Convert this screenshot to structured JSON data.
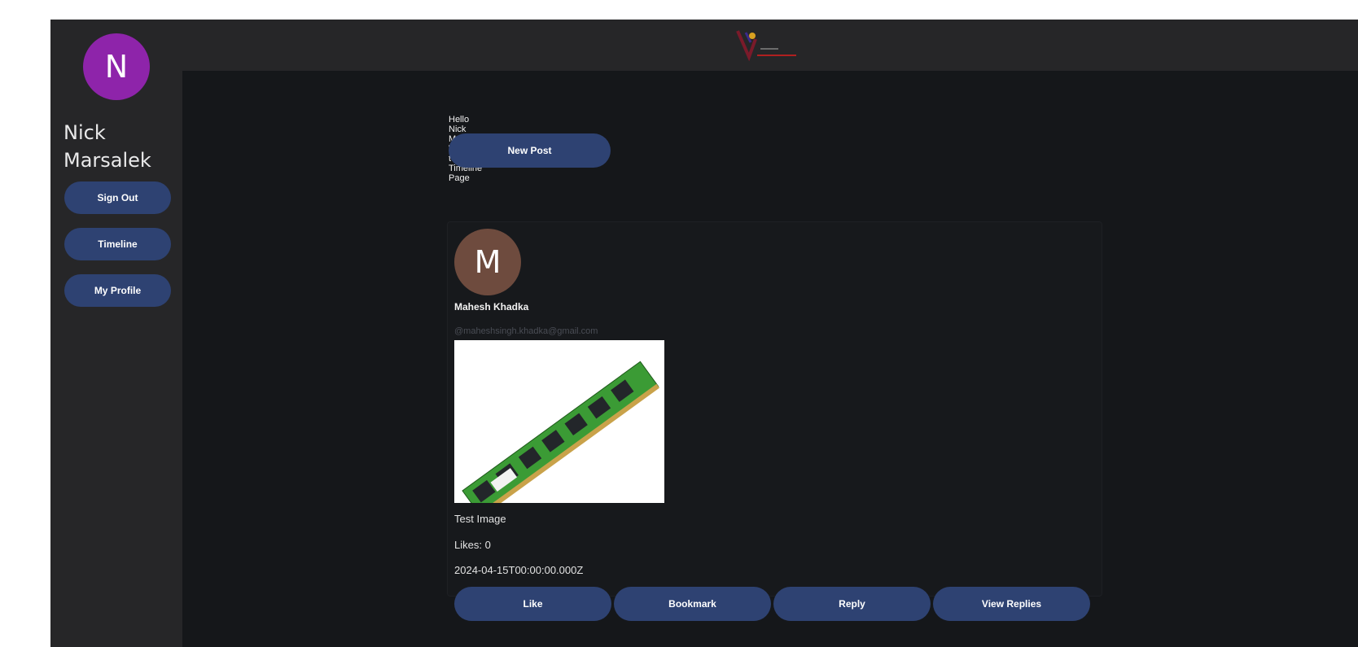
{
  "sidebar": {
    "avatar_letter": "N",
    "username": "Nick Marsalek",
    "buttons": [
      "Sign Out",
      "Timeline",
      "My Profile"
    ]
  },
  "header": {
    "logo_icon": "brand-logo-icon"
  },
  "main": {
    "greeting": "Hello Nick Marsalek Welcome to Timeline Page",
    "new_post_label": "New Post"
  },
  "post": {
    "avatar_letter": "M",
    "author": "Mahesh Khadka",
    "handle": "@maheshsingh.khadka@gmail.com",
    "image_icon": "ram-module-image",
    "caption": "Test Image",
    "likes": "Likes: 0",
    "timestamp": "2024-04-15T00:00:00.000Z",
    "actions": [
      "Like",
      "Bookmark",
      "Reply",
      "View Replies"
    ]
  },
  "colors": {
    "background": "#15171a",
    "sidebar": "#262628",
    "button": "#2e4272",
    "avatar_primary": "#8e24aa",
    "avatar_secondary": "#6e4b3e"
  }
}
